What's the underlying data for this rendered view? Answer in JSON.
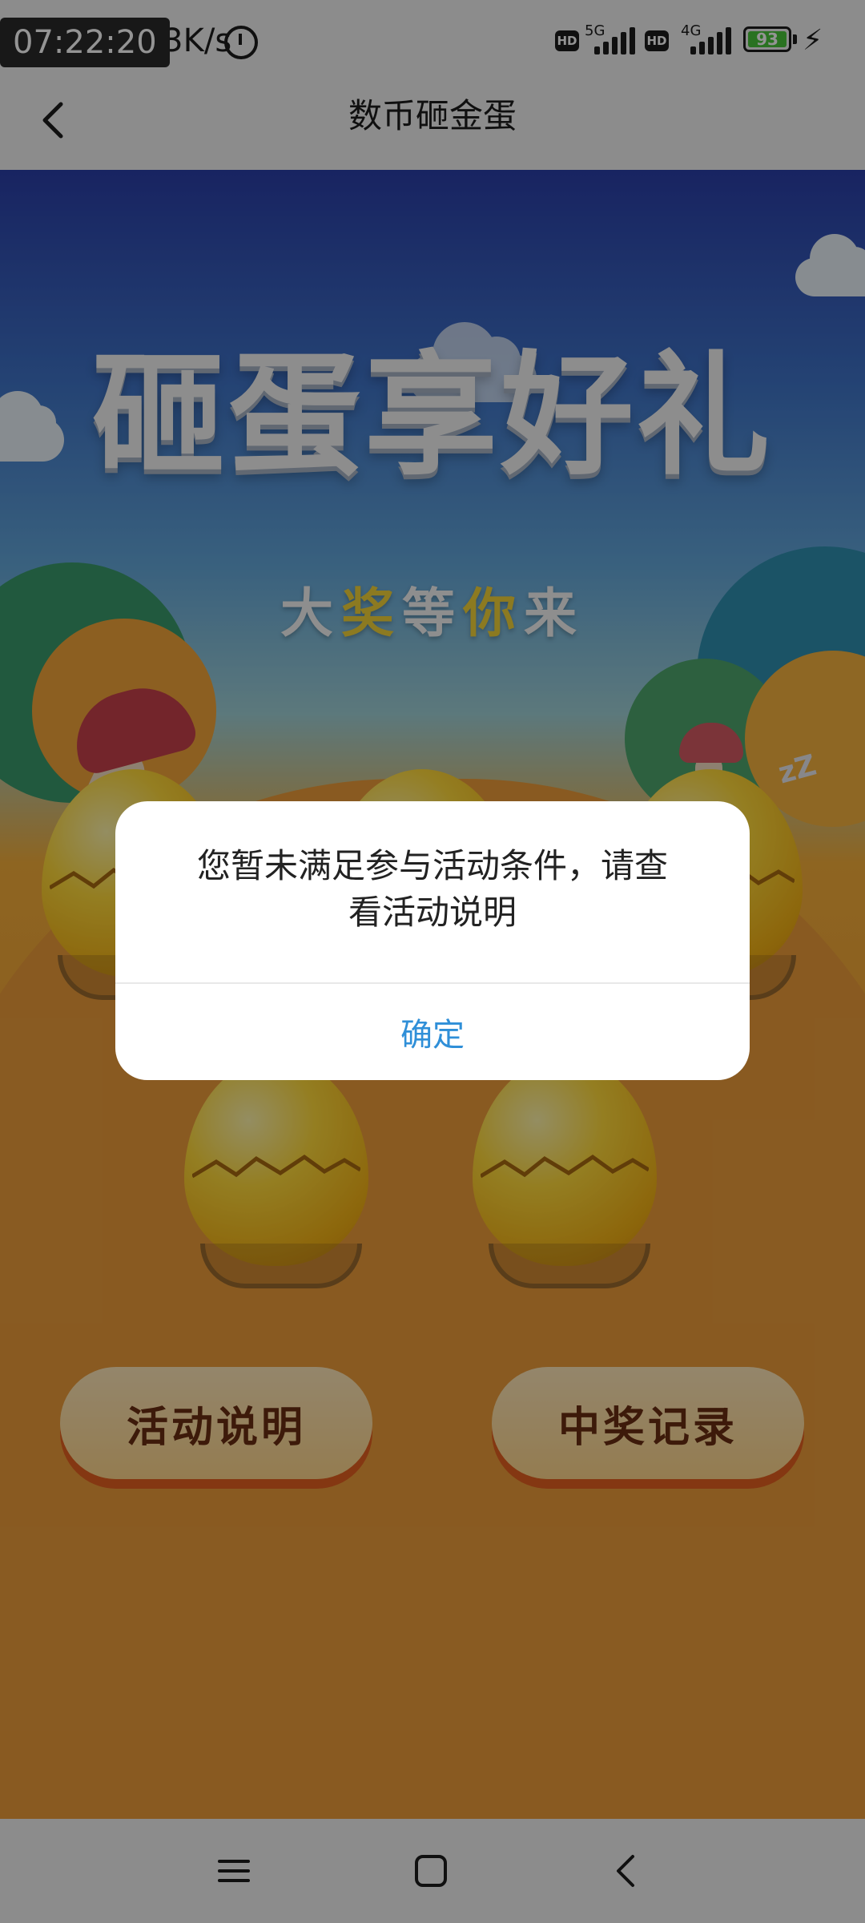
{
  "status_bar": {
    "time": "07:22:20",
    "net_speed": "9.3K/s",
    "net1": "5G",
    "net2": "4G",
    "hd_label": "HD",
    "battery_level": "93",
    "battery_color": "#49c43a"
  },
  "header": {
    "title": "数币砸金蛋"
  },
  "banner": {
    "title": "砸蛋享好礼",
    "subtitle_part1": "大",
    "subtitle_highlight": "奖",
    "subtitle_part2": "等",
    "subtitle_highlight2": "你",
    "subtitle_part3": "来"
  },
  "eggs": {
    "zzz": "zZ"
  },
  "buttons": {
    "rules": "活动说明",
    "records": "中奖记录"
  },
  "dialog": {
    "message": "您暂未满足参与活动条件，请查看活动说明",
    "confirm": "确定"
  },
  "colors": {
    "accent": "#2f8fd8",
    "button_shadow": "#e35f1f",
    "button_text": "#6a2e12"
  }
}
